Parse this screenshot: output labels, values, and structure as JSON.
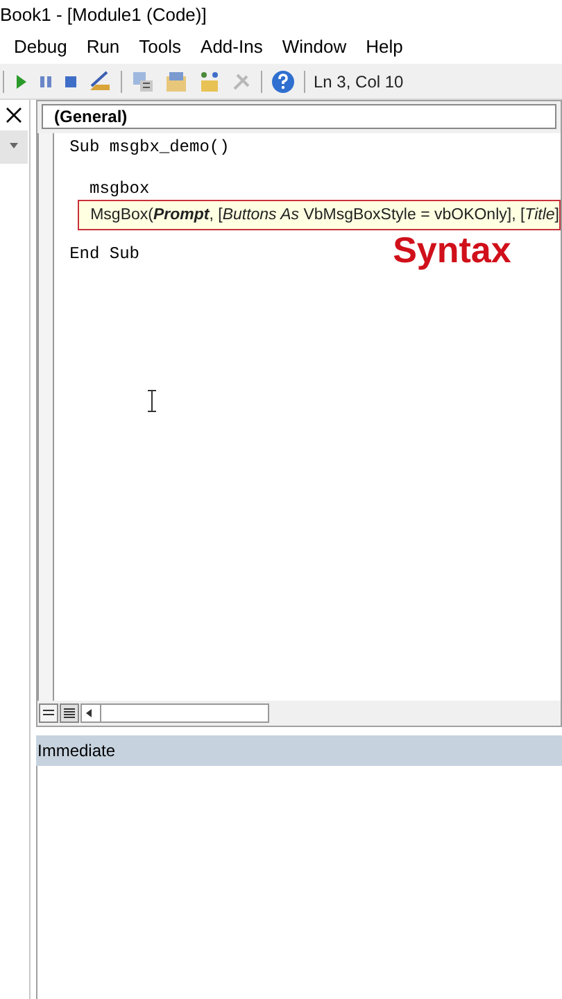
{
  "window": {
    "title": "Book1 - [Module1 (Code)]"
  },
  "menu": [
    "Debug",
    "Run",
    "Tools",
    "Add-Ins",
    "Window",
    "Help"
  ],
  "toolbar": {
    "position": "Ln 3, Col 10"
  },
  "code_window": {
    "object_box": "(General)",
    "code_before_tooltip": "Sub msgbx_demo()\n\n  msgbox",
    "tooltip": "MsgBox(**Prompt**, [*Buttons As* VbMsgBoxStyle = vbOKOnly], [*Title*]",
    "code_after_tooltip": "End Sub",
    "annotation": "Syntax"
  },
  "immediate": {
    "title": "Immediate"
  }
}
